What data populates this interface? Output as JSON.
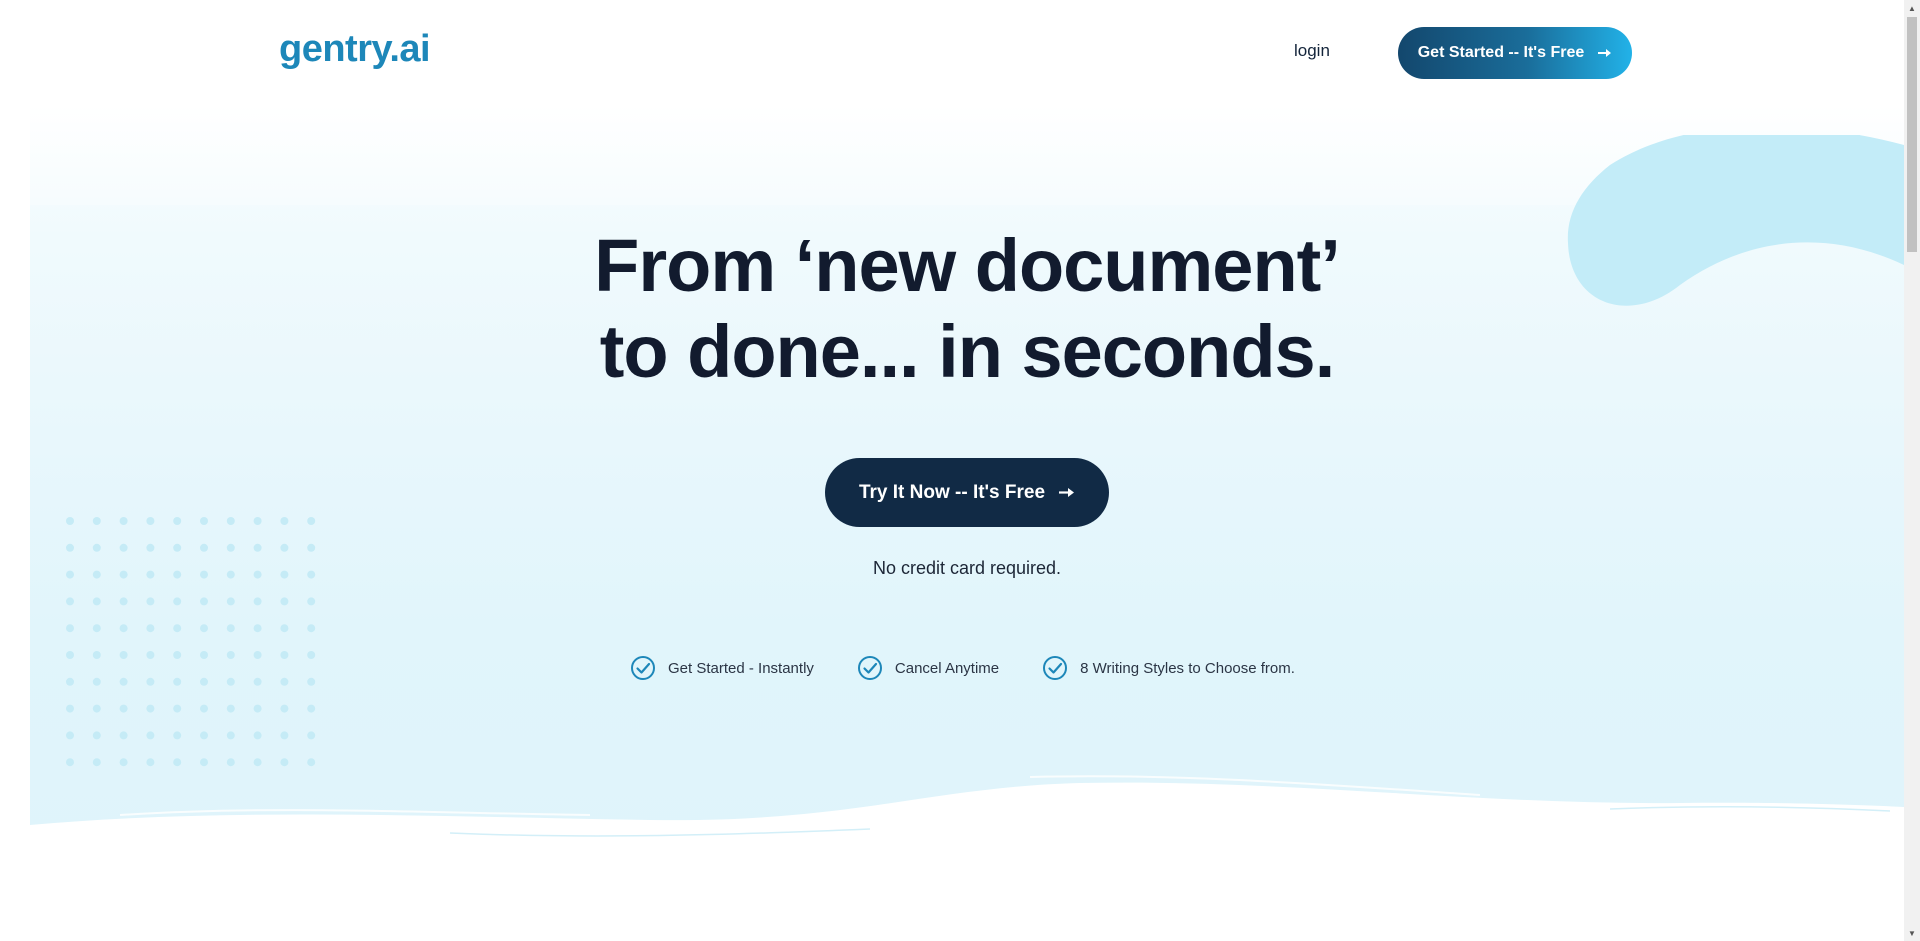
{
  "header": {
    "logo": "gentry.ai",
    "login_label": "login",
    "cta_label": "Get Started -- It's Free"
  },
  "hero": {
    "headline_line1": "From ‘new document’",
    "headline_line2": "to done... in seconds.",
    "cta_label": "Try It Now -- It's Free",
    "subtext": "No credit card required.",
    "features": [
      "Get Started - Instantly",
      "Cancel Anytime",
      "8 Writing Styles to Choose from."
    ]
  },
  "icons": {
    "arrow": "arrow-right-icon",
    "check": "check-circle-icon"
  },
  "colors": {
    "brand": "#1d87b9",
    "dark_button": "#112a45",
    "hero_accent": "#c3ecf8",
    "check": "#1d87b9"
  }
}
